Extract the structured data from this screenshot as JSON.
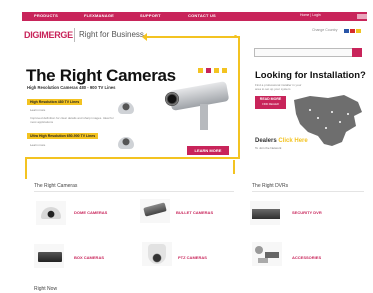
{
  "nav": {
    "items": [
      "PRODUCTS",
      "FLEXMANAGE",
      "SUPPORT",
      "CONTACT US"
    ],
    "util": "Home | Login"
  },
  "header": {
    "logo": "DIGIMERGE",
    "tagline": "Right for Business",
    "country_label": "Change Country"
  },
  "hero": {
    "title": "The Right Cameras",
    "subtitle": "High Resolution Cameras 480 - 900 TV Lines",
    "item1_label": "High Resolution 480 TV Lines",
    "item1_link": "Learn more",
    "item1_text": "Improved definition for clear details and sharp images. Ideal for most applications",
    "item2_label": "Ultra High Resolution 650-900 TV Lines",
    "item2_link": "Learn more",
    "learn_more": "LEARN MORE"
  },
  "install": {
    "title": "Looking for Installation?",
    "text": "Find a professional installer in your area to set up your system",
    "read_more": "READ MORE",
    "read_more_sub": "FIND DEALER",
    "dealers_prefix": "Dealers",
    "dealers_highlight": "Click Here",
    "dealers_sub": "To Join the Network"
  },
  "cameras": {
    "title": "The Right Cameras",
    "items": [
      "DOME CAMERAS",
      "BULLET CAMERAS",
      "BOX CAMERAS",
      "PTZ CAMERAS"
    ]
  },
  "dvrs": {
    "title": "The Right DVRs",
    "items": [
      "SECURITY DVR",
      "ACCESSORIES"
    ]
  },
  "footer_hint": "Right Now",
  "colors": {
    "brand": "#c8245a",
    "accent": "#f3c321"
  }
}
